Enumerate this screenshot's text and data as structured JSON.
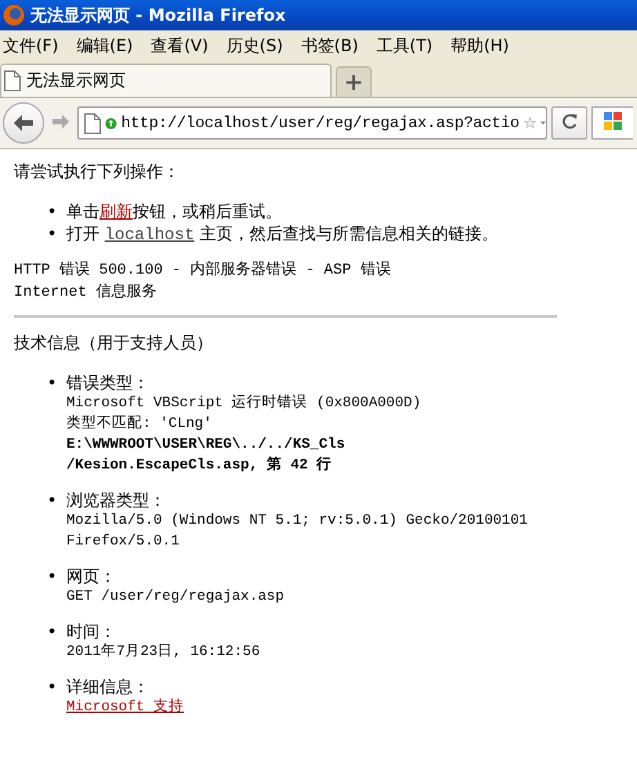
{
  "window": {
    "title": "无法显示网页 - Mozilla Firefox"
  },
  "menu_bar": [
    "文件(F)",
    "编辑(E)",
    "查看(V)",
    "历史(S)",
    "书签(B)",
    "工具(T)",
    "帮助(H)"
  ],
  "tabs": [
    {
      "label": "无法显示网页",
      "selected": true
    }
  ],
  "new_tab": "+",
  "address_bar": {
    "value": "http://localhost/user/reg/regajax.asp?actio"
  },
  "page": {
    "instruction": "请尝试执行下列操作：",
    "suggestions": [
      {
        "marker": "•",
        "segments": [
          {
            "text": "单击"
          },
          {
            "text": "刷新",
            "kind": "link"
          },
          {
            "text": "按钮，或稍后重试。"
          }
        ]
      },
      {
        "marker": "•",
        "segments": [
          {
            "text": "打开 "
          },
          {
            "text": "localhost",
            "kind": "link"
          },
          {
            "text": " 主页，然后查找与所需信息相关的链接。"
          }
        ]
      }
    ],
    "error_lines": [
      "HTTP 错误 500.100 - 内部服务器错误 - ASP 错误",
      "Internet 信息服务"
    ],
    "tech_heading": "技术信息（用于支持人员）",
    "details": [
      {
        "marker": "•",
        "label": "错误类型：",
        "lines": [
          {
            "text": "Microsoft VBScript 运行时错误 (0x800A000D)",
            "kind": "plain"
          },
          {
            "text": "类型不匹配: 'CLng'",
            "kind": "plain"
          },
          {
            "text": "E:\\WWWROOT\\USER\\REG\\../../KS_Cls",
            "kind": "bold"
          },
          {
            "text": "/Kesion.EscapeCls.asp, 第 42 行",
            "kind": "bold"
          }
        ]
      },
      {
        "marker": "•",
        "label": "浏览器类型：",
        "lines": [
          {
            "text": "Mozilla/5.0 (Windows NT 5.1; rv:5.0.1) Gecko/20100101",
            "kind": "plain"
          },
          {
            "text": "Firefox/5.0.1",
            "kind": "plain"
          }
        ]
      },
      {
        "marker": "•",
        "label": "网页：",
        "lines": [
          {
            "text": "GET /user/reg/regajax.asp",
            "kind": "plain"
          }
        ]
      },
      {
        "marker": "•",
        "label": "时间：",
        "lines": [
          {
            "text": "2011年7月23日, 16:12:56",
            "kind": "plain"
          }
        ]
      },
      {
        "marker": "•",
        "label": "详细信息：",
        "lines": [
          {
            "text": "Microsoft 支持",
            "kind": "link"
          }
        ]
      }
    ]
  }
}
